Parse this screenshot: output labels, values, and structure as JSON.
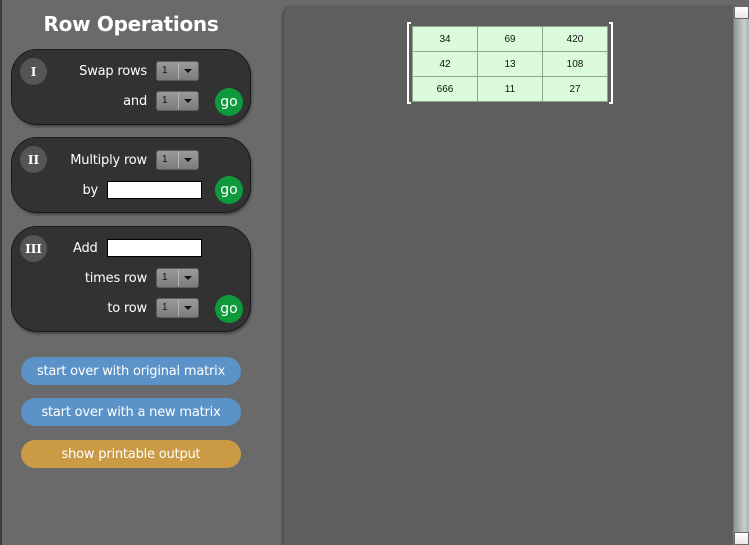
{
  "sidebar": {
    "title": "Row Operations",
    "operations": [
      {
        "numeral": "I",
        "label1": "Swap rows",
        "select1": "1",
        "label2": "and",
        "select2": "1",
        "go": "go"
      },
      {
        "numeral": "II",
        "label1": "Multiply row",
        "select1": "1",
        "label2": "by",
        "input_value": "",
        "go": "go"
      },
      {
        "numeral": "III",
        "label1": "Add",
        "input_value": "",
        "label2": "times row",
        "select1": "1",
        "label3": "to row",
        "select2": "1",
        "go": "go"
      }
    ],
    "buttons": {
      "start_over_original": "start over with original matrix",
      "start_over_new": "start over with a new matrix",
      "printable": "show printable output"
    }
  },
  "matrix": {
    "rows": [
      [
        "34",
        "69",
        "420"
      ],
      [
        "42",
        "13",
        "108"
      ],
      [
        "666",
        "11",
        "27"
      ]
    ]
  },
  "colors": {
    "go": "#0e9a3a",
    "start_over": "#5b93c8",
    "printable": "#cb9a45",
    "matrix_cell": "#dbfbdc"
  }
}
